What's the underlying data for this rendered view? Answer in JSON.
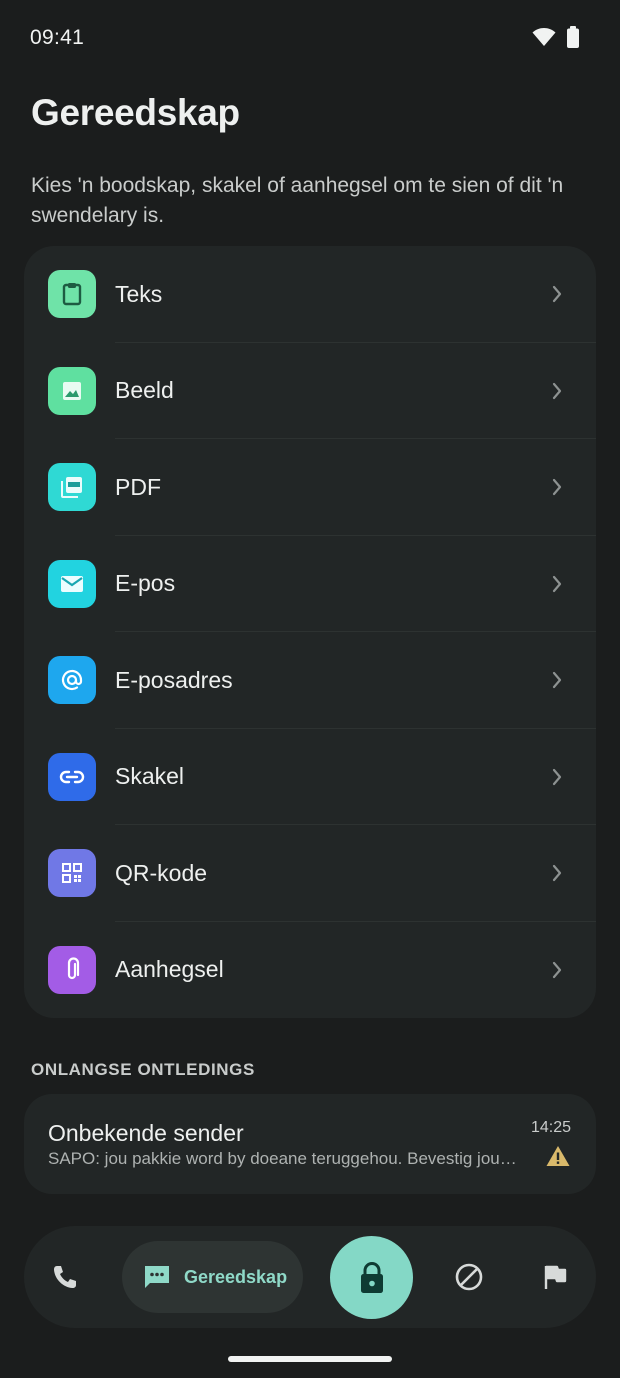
{
  "status": {
    "time": "09:41"
  },
  "header": {
    "title": "Gereedskap",
    "description": "Kies 'n boodskap, skakel of aanhegsel om te sien of dit 'n swendelary is."
  },
  "tools": [
    {
      "label": "Teks",
      "icon": "clipboard-icon",
      "color": "#6fe3a8"
    },
    {
      "label": "Beeld",
      "icon": "image-icon",
      "color": "#5fe0a0"
    },
    {
      "label": "PDF",
      "icon": "pdf-icon",
      "color": "#2fd9d4"
    },
    {
      "label": "E-pos",
      "icon": "mail-icon",
      "color": "#22d3e0"
    },
    {
      "label": "E-posadres",
      "icon": "at-sign-icon",
      "color": "#1ea7ee"
    },
    {
      "label": "Skakel",
      "icon": "link-icon",
      "color": "#2f6be9"
    },
    {
      "label": "QR-kode",
      "icon": "qr-code-icon",
      "color": "#7078e6"
    },
    {
      "label": "Aanhegsel",
      "icon": "paperclip-icon",
      "color": "#a35ce6"
    }
  ],
  "recent": {
    "section_title": "ONLANGSE ONTLEDINGS",
    "items": [
      {
        "sender": "Onbekende sender",
        "preview": "SAPO: jou pakkie word by doeane teruggehou. Bevestig jou adres en betaal die doeanegelde",
        "time": "14:25",
        "status_icon": "warning-icon",
        "status_color": "#d9b96b"
      }
    ]
  },
  "nav": {
    "active_label": "Gereedskap",
    "items": [
      "phone-icon",
      "tools-chat-icon",
      "lock-icon",
      "block-icon",
      "flag-icon"
    ],
    "accent": "#84d8c6"
  }
}
